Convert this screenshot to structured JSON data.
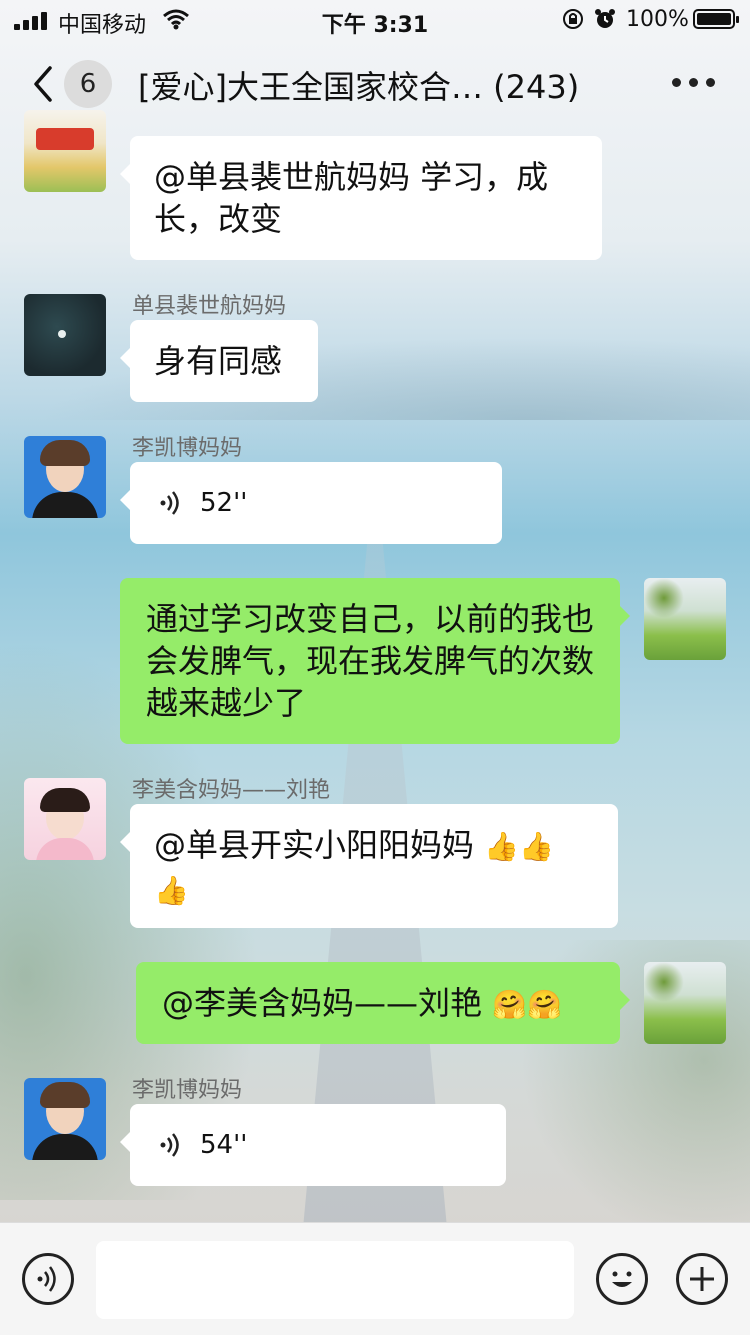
{
  "status_bar": {
    "carrier": "中国移动",
    "time": "下午 3:31",
    "battery": "100%"
  },
  "nav": {
    "unread_count": "6",
    "title": "[爱心]大王全国家校合…",
    "member_count": "(243)"
  },
  "messages": [
    {
      "side": "left",
      "sender": "",
      "text": "@单县裴世航妈妈 学习，成长，改变"
    },
    {
      "side": "left",
      "sender": "单县裴世航妈妈",
      "text": "身有同感"
    },
    {
      "side": "left",
      "sender": "李凯博妈妈",
      "type": "voice",
      "duration": "52''"
    },
    {
      "side": "right",
      "sender": "",
      "text": "通过学习改变自己，以前的我也会发脾气，现在我发脾气的次数越来越少了"
    },
    {
      "side": "left",
      "sender": "李美含妈妈——刘艳",
      "text": "@单县开实小阳阳妈妈",
      "emojis": [
        "thumbs-up",
        "thumbs-up",
        "thumbs-up"
      ]
    },
    {
      "side": "right",
      "sender": "",
      "text": "@李美含妈妈——刘艳",
      "emojis": [
        "hug",
        "hug"
      ]
    },
    {
      "side": "left",
      "sender": "李凯博妈妈",
      "type": "voice",
      "duration": "54''"
    }
  ],
  "input_bar": {
    "left_icon": "voice-mode-icon",
    "right_icons": [
      "emoji-icon",
      "plus-icon"
    ]
  },
  "colors": {
    "outgoing_bubble": "#95ec69",
    "incoming_bubble": "#ffffff"
  }
}
